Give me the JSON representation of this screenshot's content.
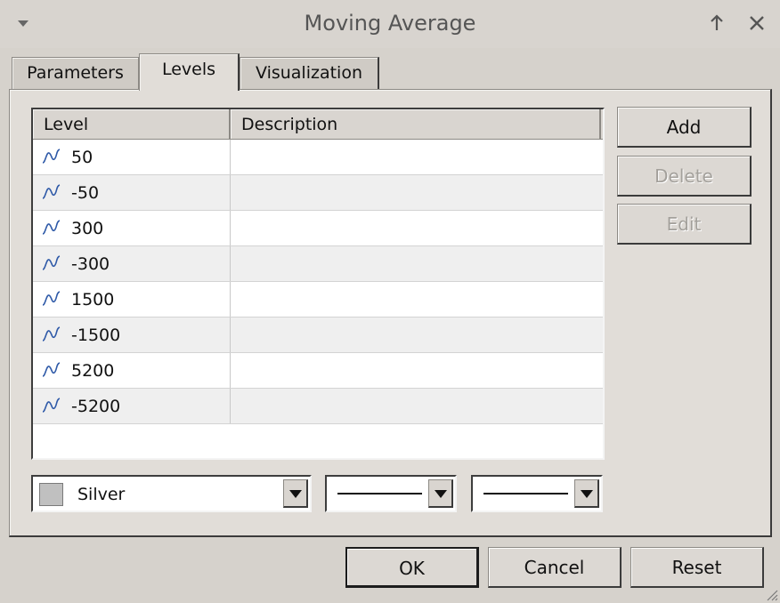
{
  "window": {
    "title": "Moving Average"
  },
  "tabs": [
    {
      "label": "Parameters"
    },
    {
      "label": "Levels"
    },
    {
      "label": "Visualization"
    }
  ],
  "levels_table": {
    "columns": [
      "Level",
      "Description"
    ],
    "rows": [
      {
        "level": "50",
        "description": ""
      },
      {
        "level": "-50",
        "description": ""
      },
      {
        "level": "300",
        "description": ""
      },
      {
        "level": "-300",
        "description": ""
      },
      {
        "level": "1500",
        "description": ""
      },
      {
        "level": "-1500",
        "description": ""
      },
      {
        "level": "5200",
        "description": ""
      },
      {
        "level": "-5200",
        "description": ""
      }
    ]
  },
  "side_buttons": {
    "add": "Add",
    "delete": "Delete",
    "edit": "Edit"
  },
  "style_controls": {
    "color_name": "Silver",
    "color_hex": "#c0c0c0"
  },
  "footer_buttons": {
    "ok": "OK",
    "cancel": "Cancel",
    "reset": "Reset"
  },
  "icons": {
    "menu": "chevron-down-icon",
    "up": "arrow-up-icon",
    "close": "close-icon",
    "level": "level-line-icon"
  }
}
